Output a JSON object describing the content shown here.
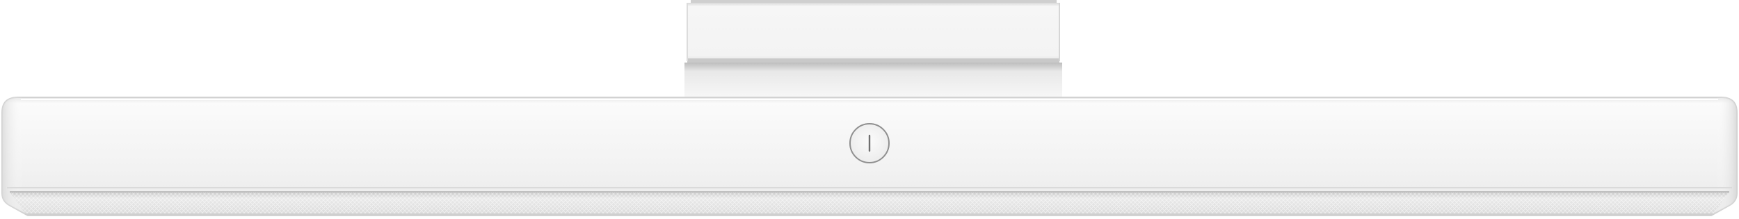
{
  "image": {
    "subject": "",
    "background_color": "#ffffff",
    "body_color": "#f2f2f2",
    "diffuser_color": "#e3e3e3",
    "button_icon": "power-icon"
  }
}
